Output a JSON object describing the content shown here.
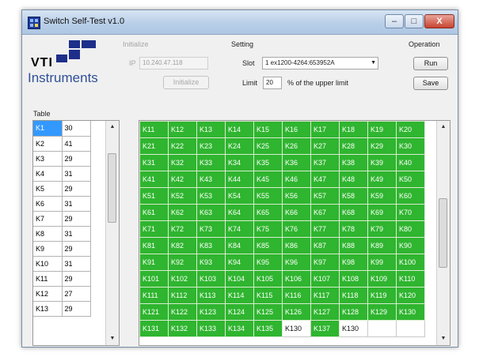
{
  "window": {
    "title": "Switch Self-Test v1.0",
    "buttons": {
      "minimize": "–",
      "maximize": "□",
      "close": "X"
    }
  },
  "logo": {
    "line1": "VTI",
    "line2": "Instruments"
  },
  "initialize": {
    "group_label": "Initialize",
    "ip_label": "IP",
    "ip_value": "10.240.47.118",
    "button_label": "Initialize"
  },
  "setting": {
    "group_label": "Setting",
    "slot_label": "Slot",
    "slot_value": "1 ex1200-4264:653952A",
    "limit_label": "Limit",
    "limit_value": "20",
    "limit_suffix": "% of the upper limit"
  },
  "operation": {
    "group_label": "Operation",
    "run_label": "Run",
    "save_label": "Save"
  },
  "table": {
    "label": "Table",
    "rows": [
      [
        "K1",
        "30"
      ],
      [
        "K2",
        "41"
      ],
      [
        "K3",
        "29"
      ],
      [
        "K4",
        "31"
      ],
      [
        "K5",
        "29"
      ],
      [
        "K6",
        "31"
      ],
      [
        "K7",
        "29"
      ],
      [
        "K8",
        "31"
      ],
      [
        "K9",
        "29"
      ],
      [
        "K10",
        "31"
      ],
      [
        "K11",
        "29"
      ],
      [
        "K12",
        "27"
      ],
      [
        "K13",
        "29"
      ]
    ],
    "scroll_fraction": 0.15
  },
  "relay_grid": {
    "rows": [
      [
        "K11",
        "K12",
        "K13",
        "K14",
        "K15",
        "K16",
        "K17",
        "K18",
        "K19",
        "K20"
      ],
      [
        "K21",
        "K22",
        "K23",
        "K24",
        "K25",
        "K26",
        "K27",
        "K28",
        "K29",
        "K30"
      ],
      [
        "K31",
        "K32",
        "K33",
        "K34",
        "K35",
        "K36",
        "K37",
        "K38",
        "K39",
        "K40"
      ],
      [
        "K41",
        "K42",
        "K43",
        "K44",
        "K45",
        "K46",
        "K47",
        "K48",
        "K49",
        "K50"
      ],
      [
        "K51",
        "K52",
        "K53",
        "K54",
        "K55",
        "K56",
        "K57",
        "K58",
        "K59",
        "K60"
      ],
      [
        "K61",
        "K62",
        "K63",
        "K64",
        "K65",
        "K66",
        "K67",
        "K68",
        "K69",
        "K70"
      ],
      [
        "K71",
        "K72",
        "K73",
        "K74",
        "K75",
        "K76",
        "K77",
        "K78",
        "K79",
        "K80"
      ],
      [
        "K81",
        "K82",
        "K83",
        "K84",
        "K85",
        "K86",
        "K87",
        "K88",
        "K89",
        "K90"
      ],
      [
        "K91",
        "K92",
        "K93",
        "K94",
        "K95",
        "K96",
        "K97",
        "K98",
        "K99",
        "K100"
      ],
      [
        "K101",
        "K102",
        "K103",
        "K104",
        "K105",
        "K106",
        "K107",
        "K108",
        "K109",
        "K110"
      ],
      [
        "K111",
        "K112",
        "K113",
        "K114",
        "K115",
        "K116",
        "K117",
        "K118",
        "K119",
        "K120"
      ],
      [
        "K121",
        "K122",
        "K123",
        "K124",
        "K125",
        "K126",
        "K127",
        "K128",
        "K129",
        "K130"
      ],
      [
        "K131",
        "K132",
        "K133",
        "K134",
        "K135",
        "K130",
        "K137",
        "K130",
        "",
        ""
      ]
    ],
    "status_last_row": [
      "pass",
      "pass",
      "pass",
      "pass",
      "pass",
      "plain",
      "pass",
      "plain",
      "plain",
      "plain"
    ],
    "pass_color": "#2fb52f",
    "scroll_fraction": 0.5
  },
  "colors": {
    "selection": "#3399ff",
    "pass": "#2fb52f",
    "logo_blue": "#1d2f8a"
  }
}
